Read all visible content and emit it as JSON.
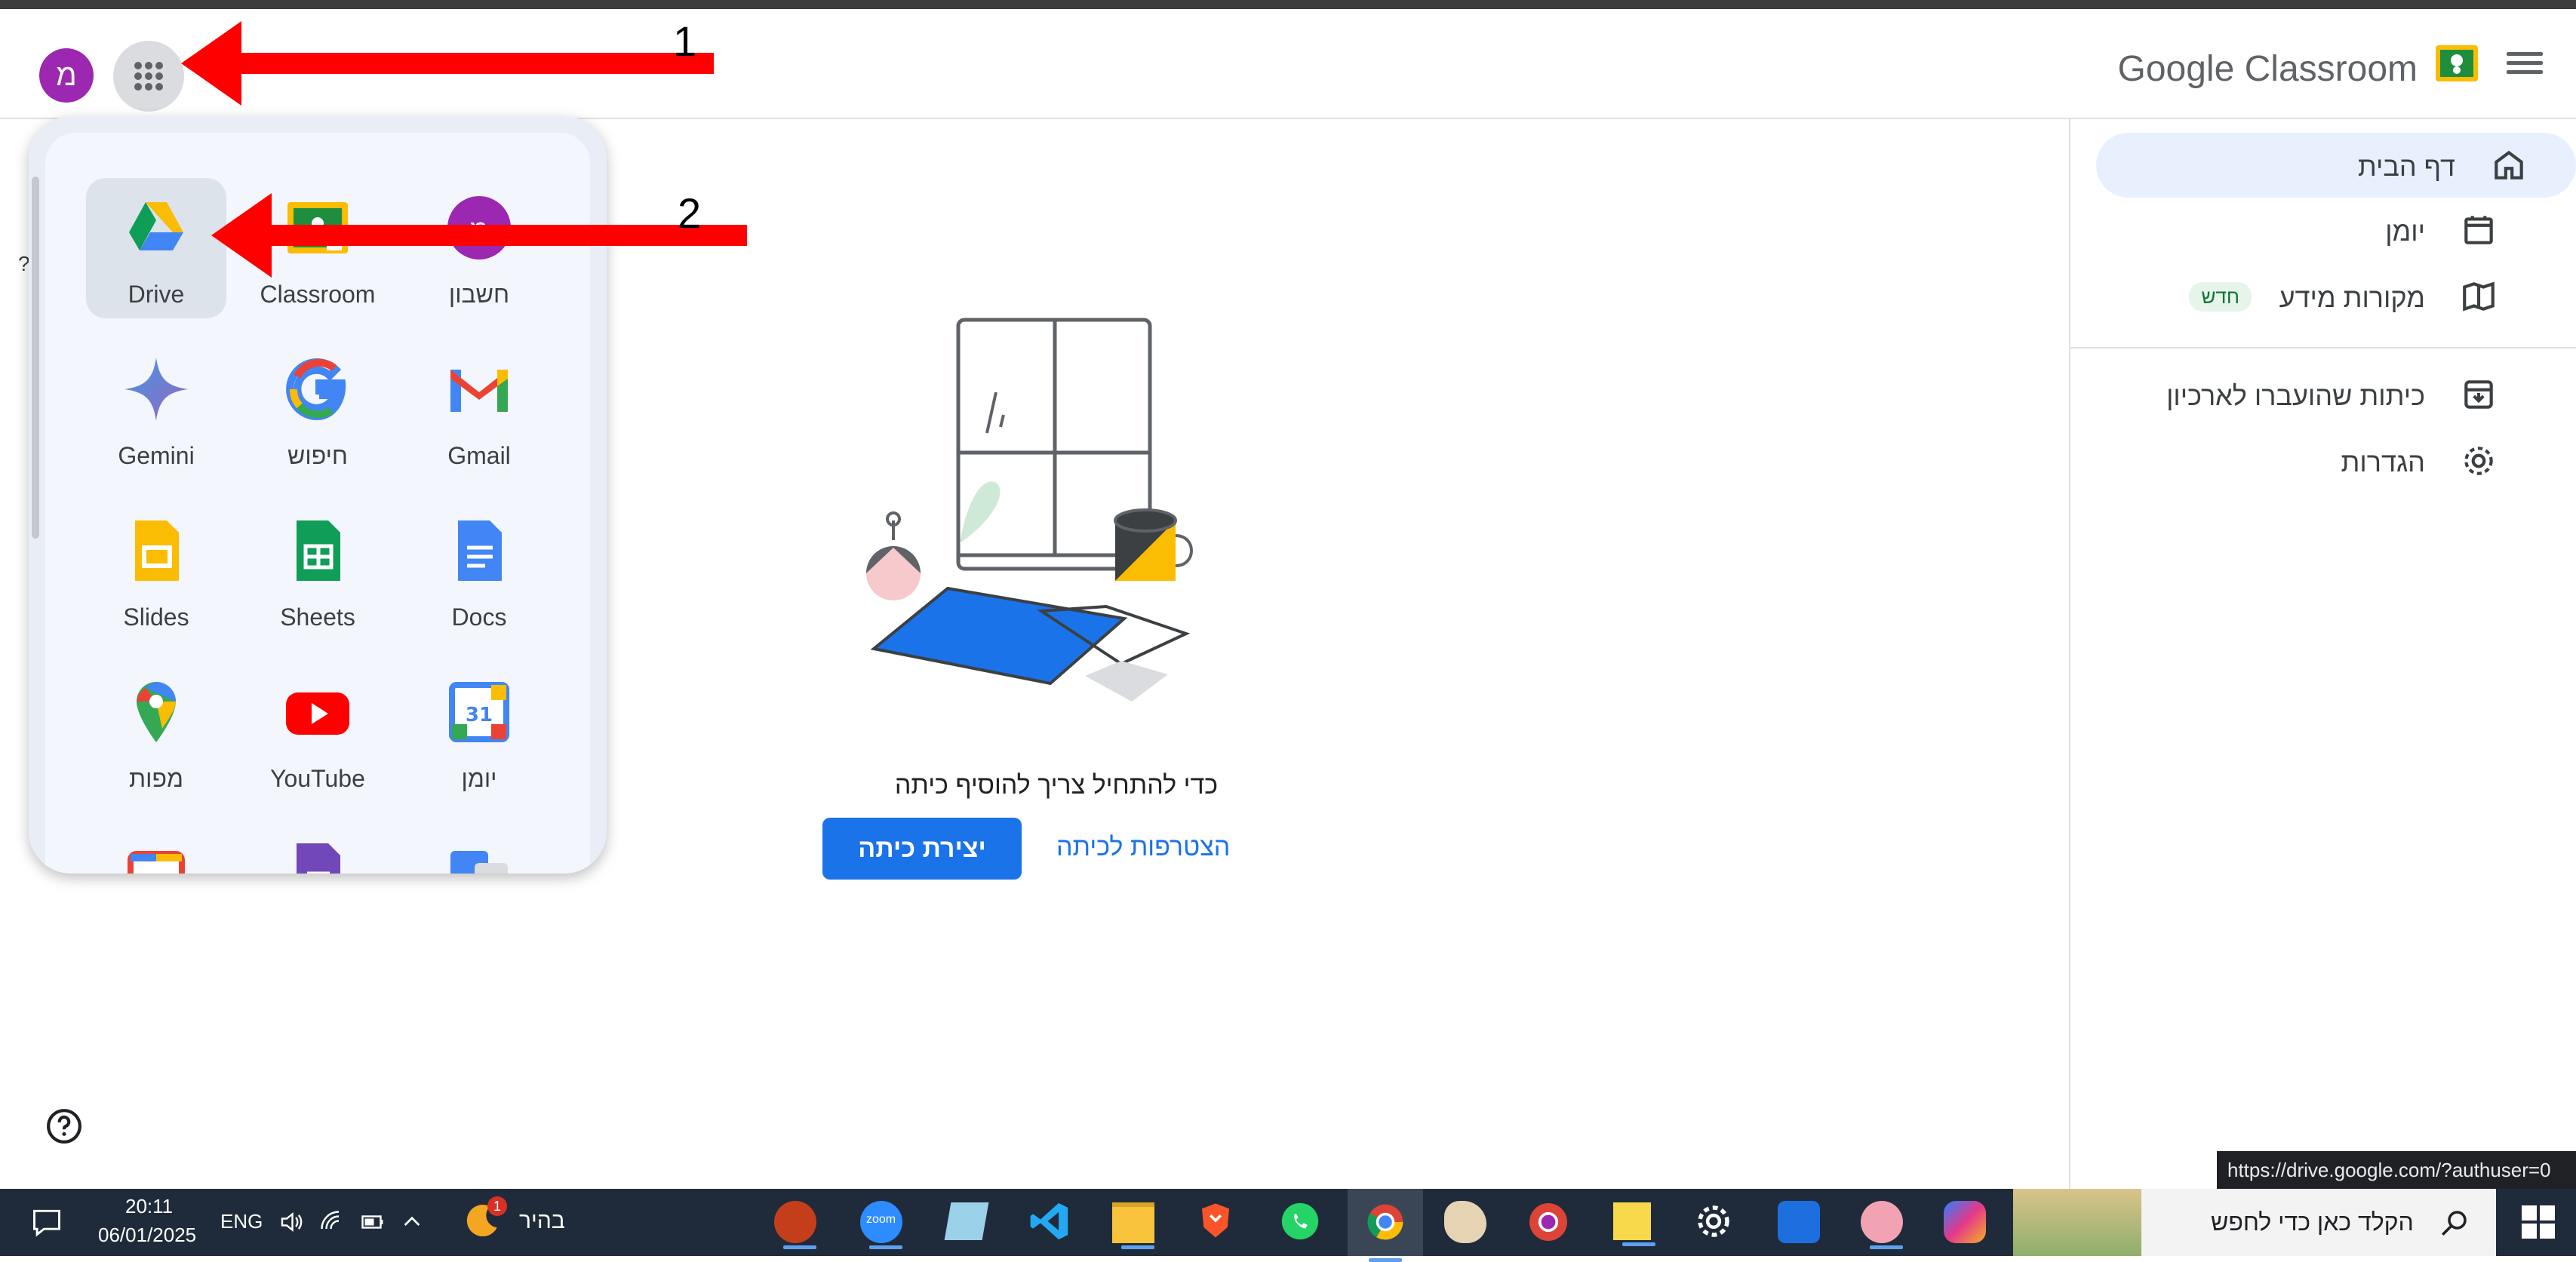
{
  "app": {
    "title": "Google Classroom",
    "avatar_letter": "מ"
  },
  "annotations": {
    "one": "1",
    "two": "2"
  },
  "nav": {
    "items": [
      {
        "label": "דף הבית",
        "icon": "home-icon",
        "active": true
      },
      {
        "label": "יומן",
        "icon": "calendar-icon"
      },
      {
        "label": "מקורות מידע",
        "icon": "book-icon",
        "badge": "חדש"
      },
      {
        "label": "כיתות שהועברו לארכיון",
        "icon": "archive-icon"
      },
      {
        "label": "הגדרות",
        "icon": "gear-icon"
      }
    ]
  },
  "launcher": {
    "apps": [
      {
        "label": "Drive",
        "icon": "drive-icon"
      },
      {
        "label": "Classroom",
        "icon": "classroom-icon"
      },
      {
        "label": "חשבון",
        "icon": "account-icon"
      },
      {
        "label": "Gemini",
        "icon": "gemini-icon"
      },
      {
        "label": "חיפוש",
        "icon": "google-search-icon"
      },
      {
        "label": "Gmail",
        "icon": "gmail-icon"
      },
      {
        "label": "Slides",
        "icon": "slides-icon"
      },
      {
        "label": "Sheets",
        "icon": "sheets-icon"
      },
      {
        "label": "Docs",
        "icon": "docs-icon"
      },
      {
        "label": "מפות",
        "icon": "maps-icon"
      },
      {
        "label": "YouTube",
        "icon": "youtube-icon"
      },
      {
        "label": "יומן",
        "icon": "calendar-app-icon"
      }
    ],
    "calendar_day": "31"
  },
  "tooltip_fragment": "?",
  "main": {
    "empty_text": "כדי להתחיל צריך להוסיף כיתה",
    "create_label": "יצירת כיתה",
    "join_label": "הצטרפות לכיתה"
  },
  "status_url": "https://drive.google.com/?authuser=0",
  "taskbar": {
    "time": "20:11",
    "date": "06/01/2025",
    "lang": "ENG",
    "weather_label": "בהיר",
    "notification_count": "1",
    "search_placeholder": "הקלד כאן כדי לחפש",
    "zoom_label": "zoom"
  },
  "colors": {
    "accent": "#1a73e8",
    "arrow": "#ff0000",
    "taskbar": "#1f2b3a"
  }
}
